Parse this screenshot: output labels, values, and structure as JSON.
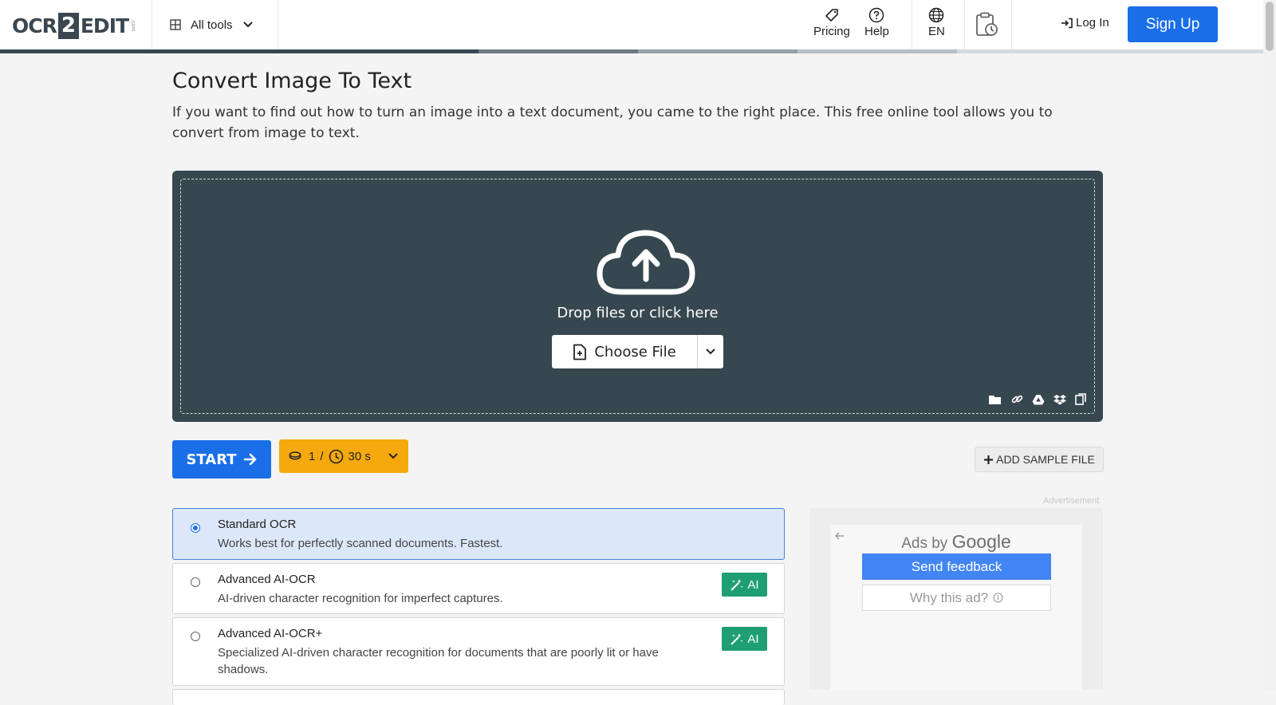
{
  "header": {
    "logo": {
      "left": "OCR",
      "number": "2",
      "right": "EDIT",
      "suffix": ".com"
    },
    "all_tools_label": "All tools",
    "nav": {
      "pricing": "Pricing",
      "help": "Help",
      "language": "EN"
    },
    "login_label": "Log In",
    "signup_label": "Sign Up"
  },
  "page": {
    "title": "Convert Image To Text",
    "description": "If you want to find out how to turn an image into a text document, you came to the right place. This free online tool allows you to convert from image to text."
  },
  "upload": {
    "drop_text": "Drop files or click here",
    "choose_label": "Choose File",
    "sources": [
      "folder-icon",
      "link-icon",
      "google-drive-icon",
      "dropbox-icon",
      "clipboard-icon"
    ]
  },
  "actions": {
    "start_label": "START",
    "credits": {
      "count": "1",
      "separator": "/",
      "time": "30 s"
    },
    "add_sample_label": "ADD SAMPLE FILE"
  },
  "ocr_options": [
    {
      "title": "Standard OCR",
      "description": "Works best for perfectly scanned documents. Fastest.",
      "selected": true,
      "ai": false
    },
    {
      "title": "Advanced AI-OCR",
      "description": "AI-driven character recognition for imperfect captures.",
      "selected": false,
      "ai": true
    },
    {
      "title": "Advanced AI-OCR+",
      "description": "Specialized AI-driven character recognition for documents that are poorly lit or have shadows.",
      "selected": false,
      "ai": true
    }
  ],
  "ai_badge_label": "AI",
  "ad": {
    "label": "Advertisement",
    "ads_by": "Ads by",
    "google": "Google",
    "send_feedback": "Send feedback",
    "why_this_ad": "Why this ad?"
  },
  "colors": {
    "primary": "#1a6fe8",
    "dropzone": "#37474f",
    "credits": "#f6a90c",
    "ai_badge": "#1e9e72",
    "selected_option": "#dce7fa"
  }
}
